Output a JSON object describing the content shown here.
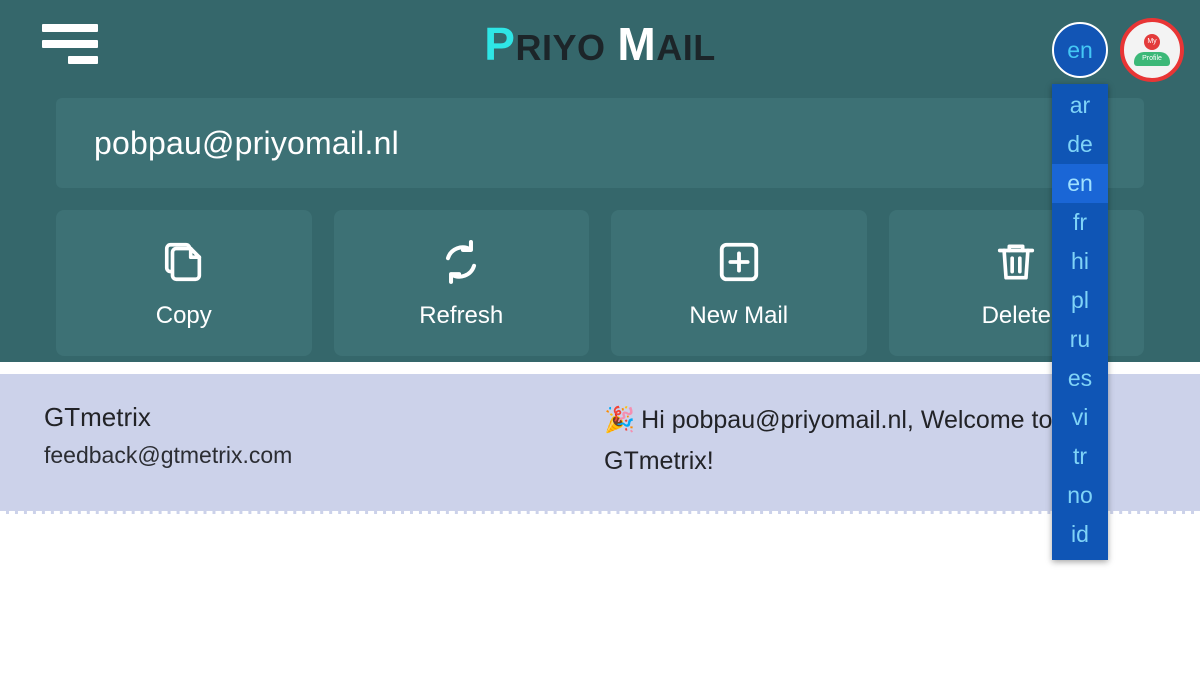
{
  "header": {
    "menu_icon": "hamburger-icon",
    "brand": {
      "word1_cap": "P",
      "word1_rest": "RIYO",
      "word2_cap": "M",
      "word2_rest": "AIL"
    },
    "language_button": {
      "label": "en",
      "icon": "globe-language-icon"
    },
    "language_menu": {
      "selected": "en",
      "options": [
        "ar",
        "de",
        "en",
        "fr",
        "hi",
        "pl",
        "ru",
        "es",
        "vi",
        "tr",
        "no",
        "id"
      ]
    },
    "profile": {
      "icon": "my-profile-avatar-icon",
      "top_text": "My",
      "bottom_text": "Profile"
    }
  },
  "address_bar": {
    "value": "pobpau@priyomail.nl",
    "placeholder": "pobpau@priyomail.nl",
    "chevron_icon": "chevron-down-icon"
  },
  "actions": [
    {
      "label": "Copy",
      "icon": "copy-icon"
    },
    {
      "label": "Refresh",
      "icon": "refresh-icon"
    },
    {
      "label": "New Mail",
      "icon": "plus-square-icon"
    },
    {
      "label": "Delete",
      "icon": "trash-icon"
    }
  ],
  "mail_list": [
    {
      "sender_name": "GTmetrix",
      "sender_email": "feedback@gtmetrix.com",
      "subject_emoji": "🎉",
      "subject": "Hi pobpau@priyomail.nl, Welcome to GTmetrix!"
    }
  ],
  "colors": {
    "header_teal": "#35676b",
    "panel_teal": "#3d7175",
    "accent_cyan": "#2ee6e6",
    "lang_blue": "#0f55b5",
    "lang_blue_selected": "#1a66d6",
    "mail_row_lavender": "#ccd2ea",
    "avatar_red": "#e83535",
    "page_white": "#ffffff"
  }
}
